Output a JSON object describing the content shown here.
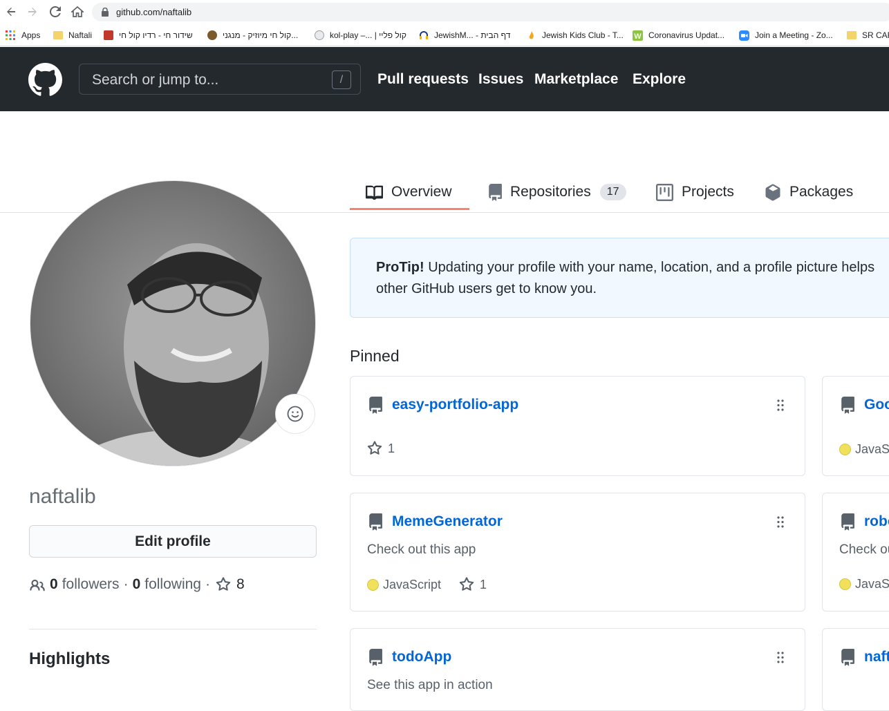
{
  "browser": {
    "url": "github.com/naftalib"
  },
  "bookmarks": [
    {
      "label": "Apps",
      "icon": "apps-grid-icon"
    },
    {
      "label": "Naftali",
      "icon": "folder-icon"
    },
    {
      "label": "שידור חי - רדיו קול חי",
      "icon": "radio-icon"
    },
    {
      "label": "קול חי מיוזיק - מנגני...",
      "icon": "music-icon"
    },
    {
      "label": "kol-play –... | קול פליי",
      "icon": "kolplay-icon"
    },
    {
      "label": "JewishM... - דף הבית",
      "icon": "headphones-icon"
    },
    {
      "label": "Jewish Kids Club - T...",
      "icon": "kids-club-icon"
    },
    {
      "label": "Coronavirus Updat...",
      "icon": "worldometer-icon"
    },
    {
      "label": "Join a Meeting - Zo...",
      "icon": "zoom-icon"
    },
    {
      "label": "SR CAR",
      "icon": "folder-icon"
    }
  ],
  "header": {
    "search_placeholder": "Search or jump to...",
    "search_shortcut": "/",
    "nav": [
      "Pull requests",
      "Issues",
      "Marketplace",
      "Explore"
    ]
  },
  "tabs": [
    {
      "label": "Overview",
      "icon": "book-icon",
      "active": true
    },
    {
      "label": "Repositories",
      "icon": "repo-icon",
      "count": "17"
    },
    {
      "label": "Projects",
      "icon": "project-icon"
    },
    {
      "label": "Packages",
      "icon": "package-icon"
    }
  ],
  "profile": {
    "username": "naftalib",
    "edit_label": "Edit profile",
    "followers": "0",
    "followers_label": "followers",
    "following": "0",
    "following_label": "following",
    "stars": "8",
    "highlights_label": "Highlights"
  },
  "protip": {
    "strong": "ProTip!",
    "text": " Updating your profile with your name, location, and a profile picture helps other GitHub users get to know you."
  },
  "pinned": {
    "title": "Pinned",
    "cards": [
      {
        "name": "easy-portfolio-app",
        "desc": "",
        "language": "",
        "stars": "1"
      },
      {
        "name": "Goo",
        "desc": "",
        "language": "JavaSc",
        "stars": ""
      },
      {
        "name": "MemeGenerator",
        "desc": "Check out this app",
        "language": "JavaScript",
        "stars": "1"
      },
      {
        "name": "robo",
        "desc": "Check ou",
        "language": "JavaSc",
        "stars": ""
      },
      {
        "name": "todoApp",
        "desc": "See this app in action",
        "language": "",
        "stars": ""
      },
      {
        "name": "naft",
        "desc": "",
        "language": "",
        "stars": ""
      }
    ]
  },
  "colors": {
    "header_bg": "#24292e",
    "link": "#0366d6",
    "tab_underline": "#f9826c",
    "javascript": "#f1e05a"
  }
}
